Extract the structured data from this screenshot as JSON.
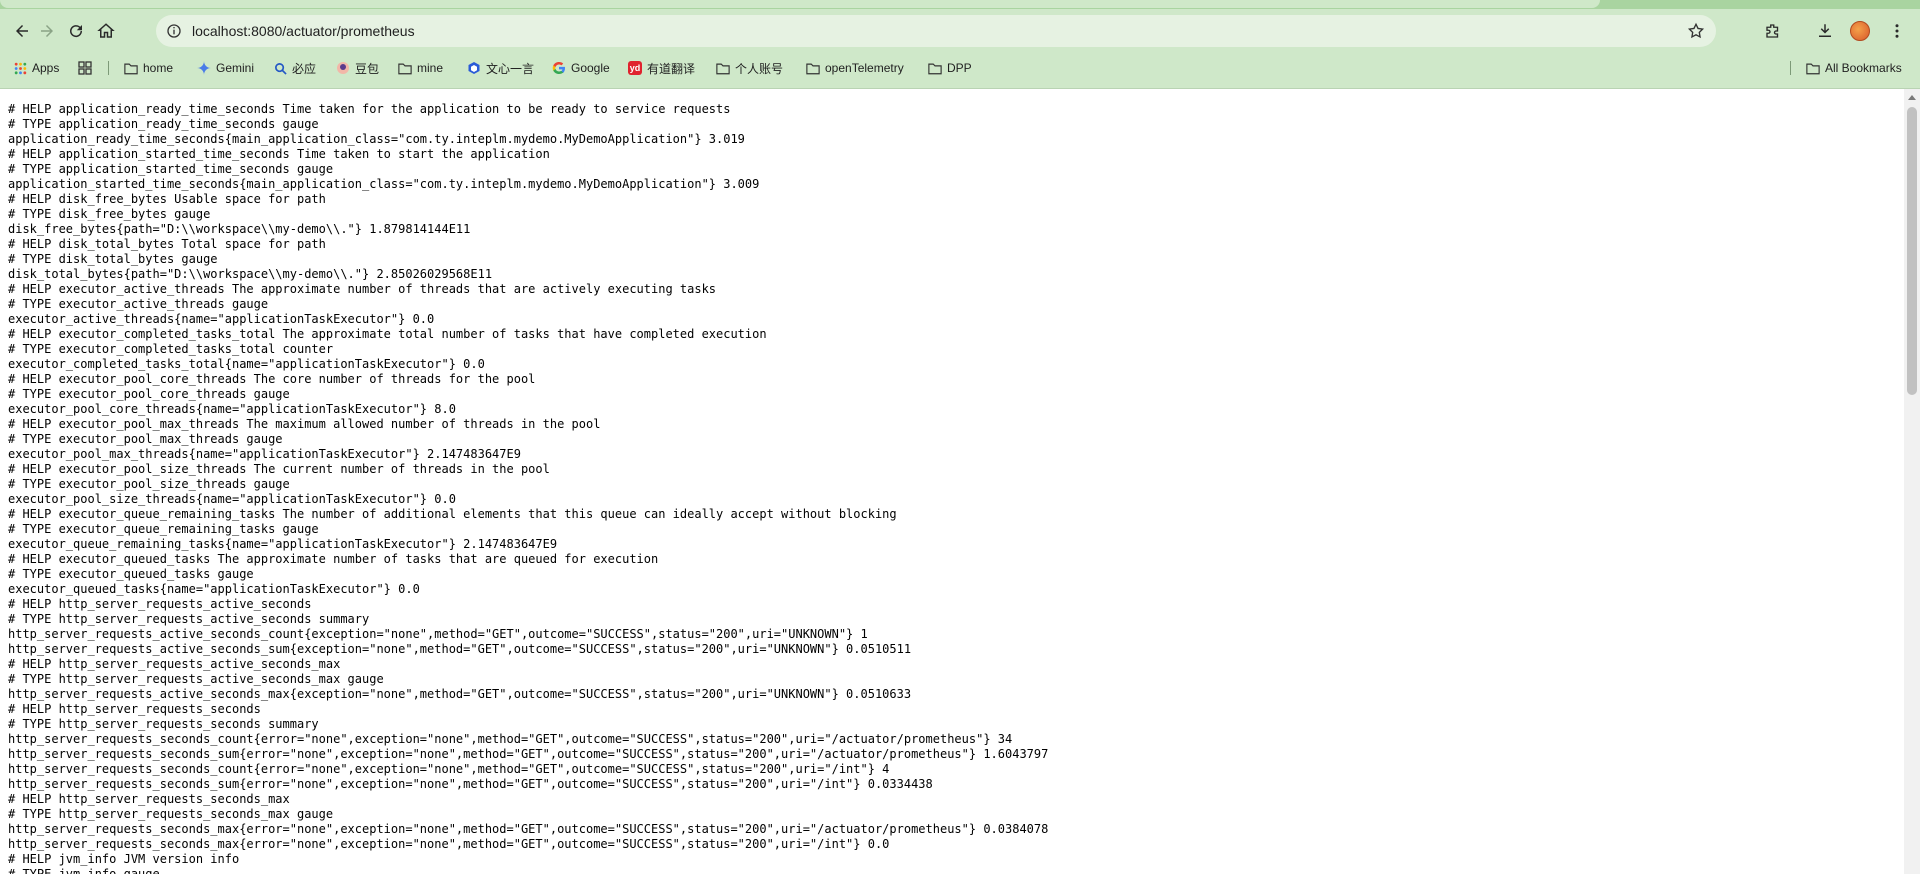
{
  "browser": {
    "url": "localhost:8080/actuator/prometheus",
    "nav": {
      "back": "back-arrow-icon",
      "forward": "forward-arrow-icon",
      "reload": "reload-icon",
      "home": "home-icon"
    },
    "bookmarks": [
      {
        "label": "Apps",
        "icon": "apps-grid-icon"
      },
      {
        "label": "",
        "icon": "tab-groups-icon"
      },
      {
        "label": "home",
        "icon": "folder-icon"
      },
      {
        "label": "Gemini",
        "icon": "gemini-icon"
      },
      {
        "label": "必应",
        "icon": "bing-search-icon"
      },
      {
        "label": "豆包",
        "icon": "doubao-icon"
      },
      {
        "label": "mine",
        "icon": "folder-icon"
      },
      {
        "label": "文心一言",
        "icon": "wenxin-icon"
      },
      {
        "label": "Google",
        "icon": "google-icon"
      },
      {
        "label": "有道翻译",
        "icon": "youdao-icon"
      },
      {
        "label": "个人账号",
        "icon": "folder-icon"
      },
      {
        "label": "openTelemetry",
        "icon": "folder-icon"
      },
      {
        "label": "DPP",
        "icon": "folder-icon"
      }
    ],
    "all_bookmarks": "All Bookmarks",
    "colors": {
      "chrome_bg": "#cfe8c9",
      "omnibox_bg": "#e6f2e2",
      "youdao_red": "#e0232e"
    }
  },
  "content": {
    "lines": [
      "# HELP application_ready_time_seconds Time taken for the application to be ready to service requests",
      "# TYPE application_ready_time_seconds gauge",
      "application_ready_time_seconds{main_application_class=\"com.ty.inteplm.mydemo.MyDemoApplication\"} 3.019",
      "# HELP application_started_time_seconds Time taken to start the application",
      "# TYPE application_started_time_seconds gauge",
      "application_started_time_seconds{main_application_class=\"com.ty.inteplm.mydemo.MyDemoApplication\"} 3.009",
      "# HELP disk_free_bytes Usable space for path",
      "# TYPE disk_free_bytes gauge",
      "disk_free_bytes{path=\"D:\\\\workspace\\\\my-demo\\\\.\"} 1.879814144E11",
      "# HELP disk_total_bytes Total space for path",
      "# TYPE disk_total_bytes gauge",
      "disk_total_bytes{path=\"D:\\\\workspace\\\\my-demo\\\\.\"} 2.85026029568E11",
      "# HELP executor_active_threads The approximate number of threads that are actively executing tasks",
      "# TYPE executor_active_threads gauge",
      "executor_active_threads{name=\"applicationTaskExecutor\"} 0.0",
      "# HELP executor_completed_tasks_total The approximate total number of tasks that have completed execution",
      "# TYPE executor_completed_tasks_total counter",
      "executor_completed_tasks_total{name=\"applicationTaskExecutor\"} 0.0",
      "# HELP executor_pool_core_threads The core number of threads for the pool",
      "# TYPE executor_pool_core_threads gauge",
      "executor_pool_core_threads{name=\"applicationTaskExecutor\"} 8.0",
      "# HELP executor_pool_max_threads The maximum allowed number of threads in the pool",
      "# TYPE executor_pool_max_threads gauge",
      "executor_pool_max_threads{name=\"applicationTaskExecutor\"} 2.147483647E9",
      "# HELP executor_pool_size_threads The current number of threads in the pool",
      "# TYPE executor_pool_size_threads gauge",
      "executor_pool_size_threads{name=\"applicationTaskExecutor\"} 0.0",
      "# HELP executor_queue_remaining_tasks The number of additional elements that this queue can ideally accept without blocking",
      "# TYPE executor_queue_remaining_tasks gauge",
      "executor_queue_remaining_tasks{name=\"applicationTaskExecutor\"} 2.147483647E9",
      "# HELP executor_queued_tasks The approximate number of tasks that are queued for execution",
      "# TYPE executor_queued_tasks gauge",
      "executor_queued_tasks{name=\"applicationTaskExecutor\"} 0.0",
      "# HELP http_server_requests_active_seconds",
      "# TYPE http_server_requests_active_seconds summary",
      "http_server_requests_active_seconds_count{exception=\"none\",method=\"GET\",outcome=\"SUCCESS\",status=\"200\",uri=\"UNKNOWN\"} 1",
      "http_server_requests_active_seconds_sum{exception=\"none\",method=\"GET\",outcome=\"SUCCESS\",status=\"200\",uri=\"UNKNOWN\"} 0.0510511",
      "# HELP http_server_requests_active_seconds_max",
      "# TYPE http_server_requests_active_seconds_max gauge",
      "http_server_requests_active_seconds_max{exception=\"none\",method=\"GET\",outcome=\"SUCCESS\",status=\"200\",uri=\"UNKNOWN\"} 0.0510633",
      "# HELP http_server_requests_seconds",
      "# TYPE http_server_requests_seconds summary",
      "http_server_requests_seconds_count{error=\"none\",exception=\"none\",method=\"GET\",outcome=\"SUCCESS\",status=\"200\",uri=\"/actuator/prometheus\"} 34",
      "http_server_requests_seconds_sum{error=\"none\",exception=\"none\",method=\"GET\",outcome=\"SUCCESS\",status=\"200\",uri=\"/actuator/prometheus\"} 1.6043797",
      "http_server_requests_seconds_count{error=\"none\",exception=\"none\",method=\"GET\",outcome=\"SUCCESS\",status=\"200\",uri=\"/int\"} 4",
      "http_server_requests_seconds_sum{error=\"none\",exception=\"none\",method=\"GET\",outcome=\"SUCCESS\",status=\"200\",uri=\"/int\"} 0.0334438",
      "# HELP http_server_requests_seconds_max",
      "# TYPE http_server_requests_seconds_max gauge",
      "http_server_requests_seconds_max{error=\"none\",exception=\"none\",method=\"GET\",outcome=\"SUCCESS\",status=\"200\",uri=\"/actuator/prometheus\"} 0.0384078",
      "http_server_requests_seconds_max{error=\"none\",exception=\"none\",method=\"GET\",outcome=\"SUCCESS\",status=\"200\",uri=\"/int\"} 0.0",
      "# HELP jvm_info JVM version info",
      "# TYPE jvm_info gauge"
    ]
  }
}
